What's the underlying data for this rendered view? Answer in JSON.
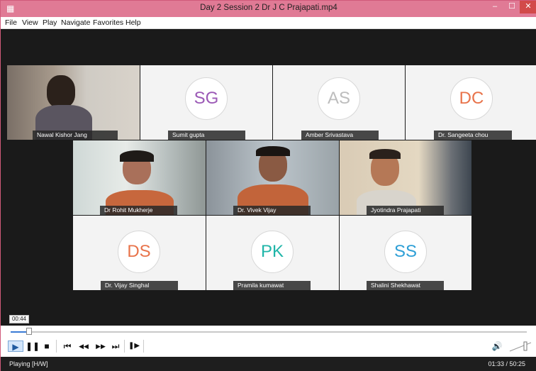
{
  "window": {
    "title": "Day 2 Session 2 Dr J C Prajapati.mp4",
    "icon": "app-icon",
    "controls": {
      "minimize": "–",
      "maximize": "☐",
      "close": "✕"
    }
  },
  "menu": [
    "File",
    "View",
    "Play",
    "Navigate",
    "Favorites",
    "Help"
  ],
  "participants": [
    {
      "name": "Nawal Kishor Jang",
      "type": "video"
    },
    {
      "name": "Sumit gupta",
      "type": "avatar",
      "initials": "SG",
      "color": "#9b59b6"
    },
    {
      "name": "Amber Srivastava",
      "type": "avatar",
      "initials": "AS",
      "color": "#bdbdbd"
    },
    {
      "name": "Dr. Sangeeta chou",
      "type": "avatar",
      "initials": "DC",
      "color": "#e8734a"
    },
    {
      "name": "Dr Rohit Mukherje",
      "type": "video"
    },
    {
      "name": "Dr. Vivek Vijay",
      "type": "video"
    },
    {
      "name": "Jyotindra Prajapati",
      "type": "video"
    },
    {
      "name": "Dr. Vijay Singhal",
      "type": "avatar",
      "initials": "DS",
      "color": "#e8734a"
    },
    {
      "name": "Pramila kumawat",
      "type": "avatar",
      "initials": "PK",
      "color": "#1fb5a8"
    },
    {
      "name": "Shalini Shekhawat",
      "type": "avatar",
      "initials": "SS",
      "color": "#2e9fd6"
    }
  ],
  "overlay_time": "00:44",
  "playback": {
    "progress": 0.03,
    "buttons": [
      "▶",
      "❚❚",
      "■",
      "⏮",
      "◀◀",
      "▶▶",
      "⏭",
      "❚▶"
    ],
    "volume_icon": "🔊"
  },
  "status": {
    "state": "Playing [H/W]",
    "time": "01:33 / 50:25"
  }
}
